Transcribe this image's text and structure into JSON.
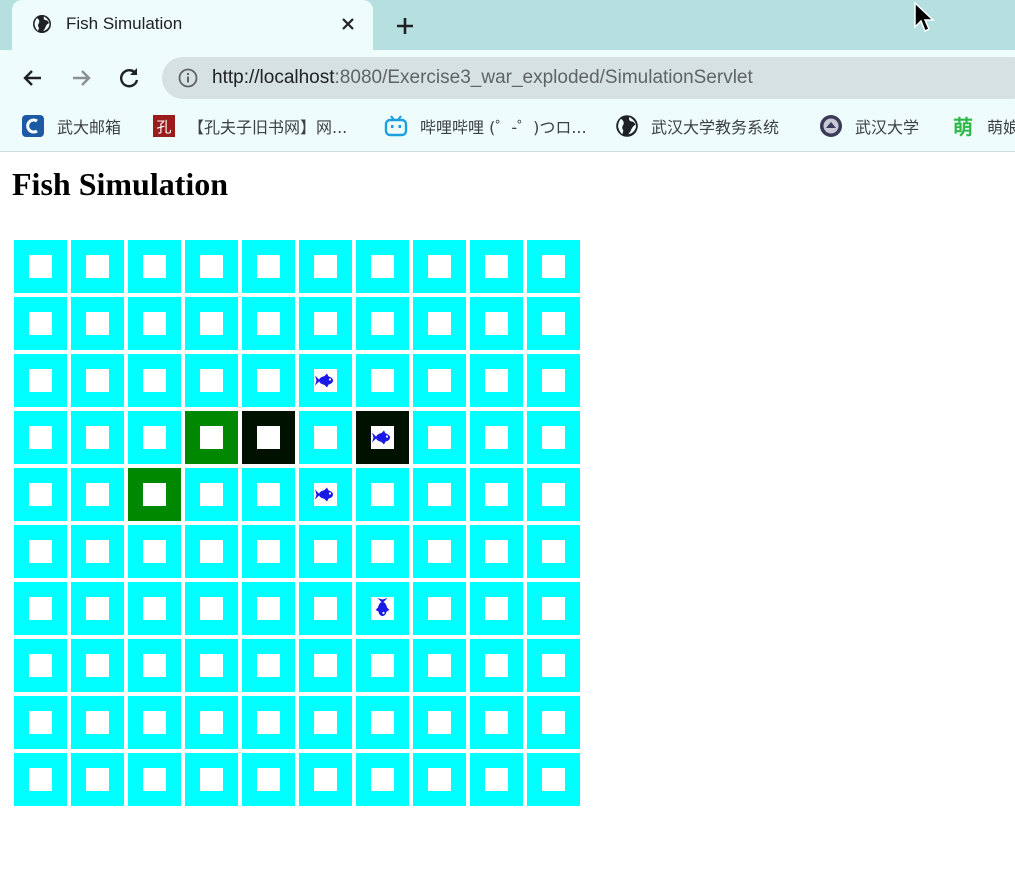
{
  "browser": {
    "tab_title": "Fish Simulation",
    "url_host": "http://localhost",
    "url_path": ":8080/Exercise3_war_exploded/SimulationServlet"
  },
  "bookmarks": [
    {
      "label": "武大邮箱",
      "icon": "c-mail-icon"
    },
    {
      "label": "【孔夫子旧书网】网...",
      "icon": "kongfuzi-icon"
    },
    {
      "label": "哔哩哔哩 (゜-゜)つロ...",
      "icon": "bilibili-icon"
    },
    {
      "label": "武汉大学教务系统",
      "icon": "globe-icon"
    },
    {
      "label": "武汉大学",
      "icon": "whu-seal-icon"
    },
    {
      "label": "萌娘",
      "icon": "moe-icon"
    }
  ],
  "page": {
    "title": "Fish Simulation"
  },
  "colors": {
    "water": "#00ffff",
    "plant": "#008800",
    "dark": "#001100",
    "fish": "#1a1ae6",
    "cell_center": "#ffffff"
  },
  "grid": {
    "rows": 10,
    "cols": 10,
    "special_cells": [
      {
        "row": 2,
        "col": 5,
        "bg": "water",
        "fish": "fish-right"
      },
      {
        "row": 3,
        "col": 3,
        "bg": "plant",
        "fish": null
      },
      {
        "row": 3,
        "col": 4,
        "bg": "dark",
        "fish": null
      },
      {
        "row": 3,
        "col": 6,
        "bg": "dark",
        "fish": "fish-right"
      },
      {
        "row": 4,
        "col": 2,
        "bg": "plant",
        "fish": null
      },
      {
        "row": 4,
        "col": 5,
        "bg": "water",
        "fish": "fish-right"
      },
      {
        "row": 6,
        "col": 6,
        "bg": "water",
        "fish": "fish-down"
      }
    ]
  }
}
